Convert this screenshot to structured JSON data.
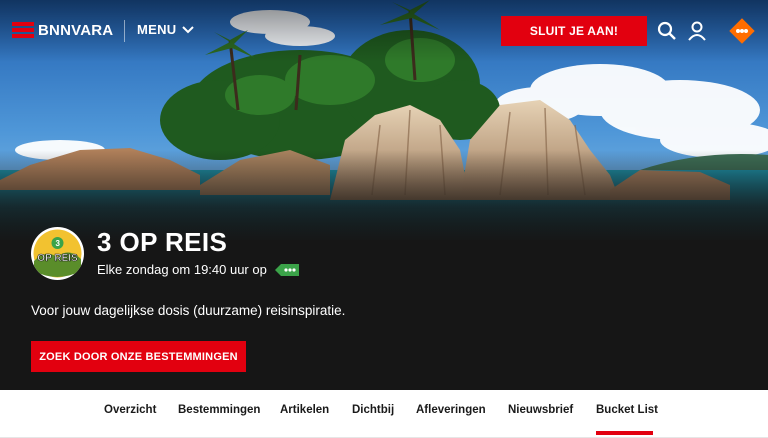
{
  "header": {
    "logo_text": "BNNVARA",
    "menu_label": "MENU",
    "join_label": "SLUIT JE AAN!",
    "icons": [
      "search-icon",
      "user-icon",
      "npo-icon"
    ],
    "accent_color": "#e2000f",
    "npo_color": "#ff6d00"
  },
  "program": {
    "title": "3 OP REIS",
    "avatar_text": "OP REIS",
    "schedule": "Elke zondag om 19:40 uur op",
    "channel_icon": "npo3-icon",
    "description": "Voor jouw dagelijkse dosis (duurzame) reisinspiratie.",
    "cta_label": "ZOEK DOOR ONZE BESTEMMINGEN"
  },
  "nav": {
    "items": [
      "Overzicht",
      "Bestemmingen",
      "Artikelen",
      "Dichtbij",
      "Afleveringen",
      "Nieuwsbrief",
      "Bucket List"
    ],
    "active": "Bucket List"
  }
}
